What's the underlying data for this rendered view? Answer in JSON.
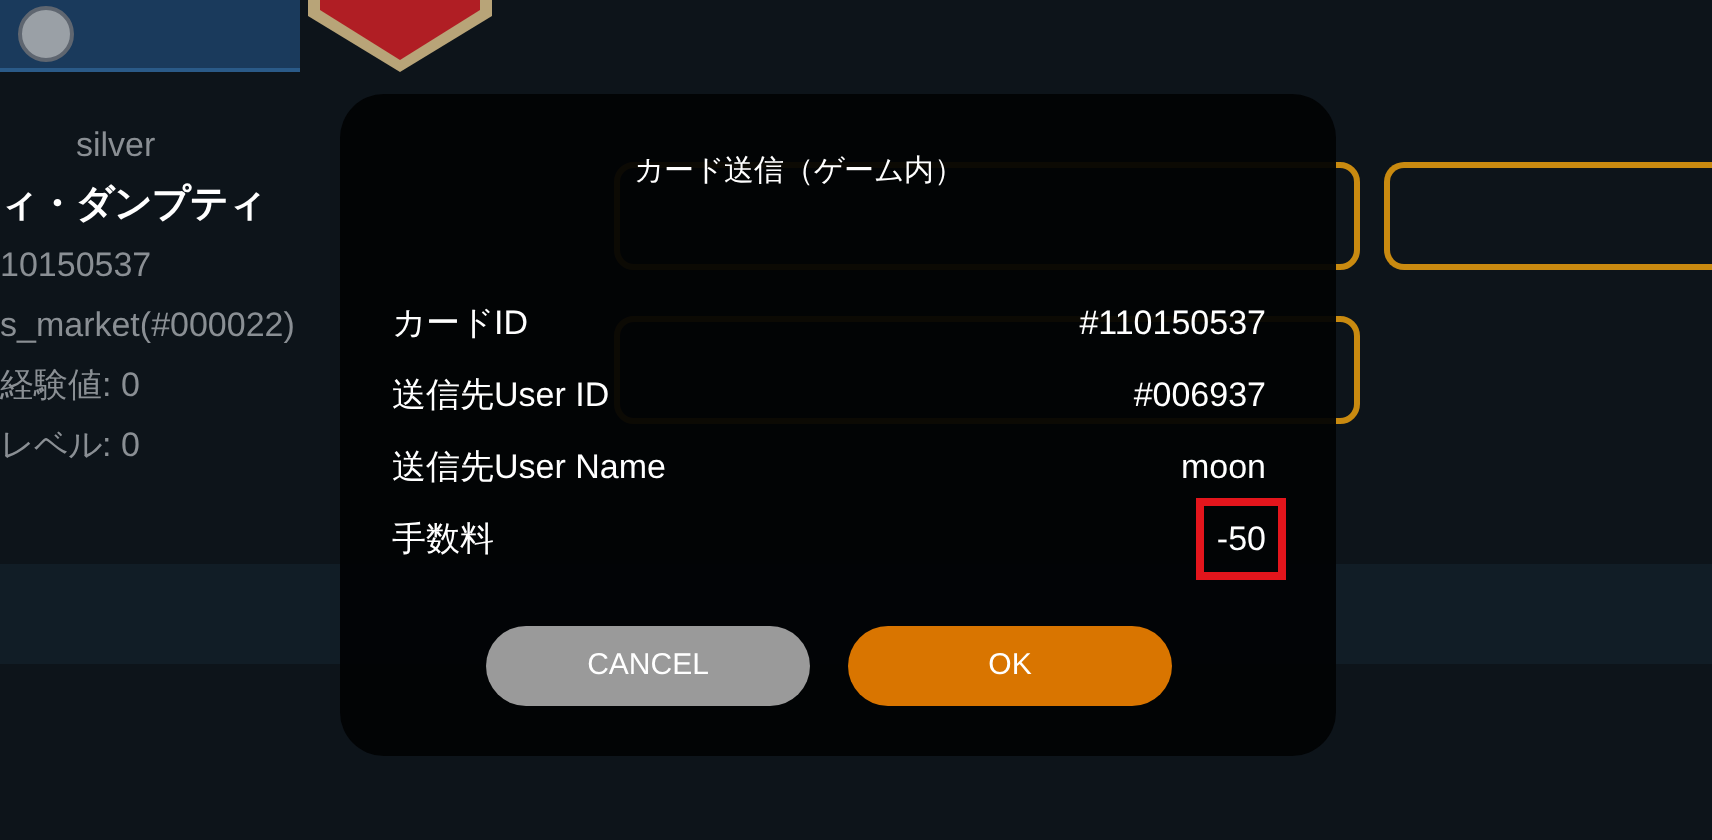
{
  "background": {
    "rank": "silver",
    "card_name": "ィ・ダンプティ",
    "card_id": "10150537",
    "owner": "s_market(#000022)",
    "stats": [
      "経験値: 0",
      "レベル: 0"
    ]
  },
  "dialog": {
    "title": "カード送信（ゲーム内）",
    "rows": [
      {
        "label": "カードID",
        "value": "#110150537",
        "highlighted": false
      },
      {
        "label": "送信先User ID",
        "value": "#006937",
        "highlighted": false
      },
      {
        "label": "送信先User Name",
        "value": "moon",
        "highlighted": false
      },
      {
        "label": "手数料",
        "value": "-50",
        "highlighted": true
      }
    ],
    "buttons": [
      {
        "label": "CANCEL",
        "kind": "cancel"
      },
      {
        "label": "OK",
        "kind": "ok"
      }
    ]
  }
}
